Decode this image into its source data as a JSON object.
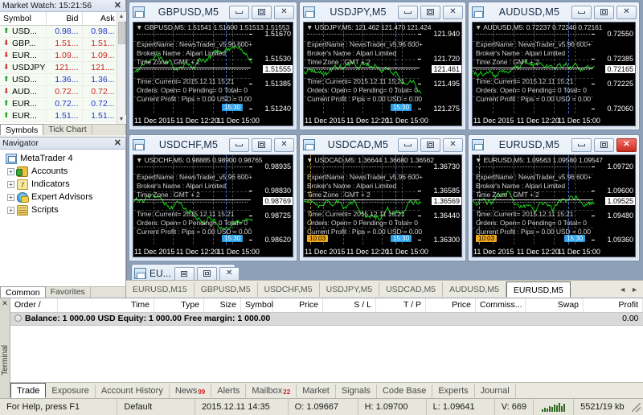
{
  "market_watch": {
    "title": "Market Watch: 15:21:56",
    "close_label": "✕",
    "columns": [
      "Symbol",
      "Bid",
      "Ask"
    ],
    "rows": [
      {
        "dir": "up",
        "symbol": "USD...",
        "bid": "0.98...",
        "ask": "0.98...",
        "px": "up"
      },
      {
        "dir": "down",
        "symbol": "GBP...",
        "bid": "1.51...",
        "ask": "1.51...",
        "px": "down"
      },
      {
        "dir": "down",
        "symbol": "EUR...",
        "bid": "1.09...",
        "ask": "1.09...",
        "px": "down"
      },
      {
        "dir": "down",
        "symbol": "USDJPY",
        "bid": "121....",
        "ask": "121....",
        "px": "down"
      },
      {
        "dir": "up",
        "symbol": "USD...",
        "bid": "1.36...",
        "ask": "1.36...",
        "px": "up"
      },
      {
        "dir": "down",
        "symbol": "AUD...",
        "bid": "0.72...",
        "ask": "0.72...",
        "px": "down"
      },
      {
        "dir": "up",
        "symbol": "EUR...",
        "bid": "0.72...",
        "ask": "0.72...",
        "px": "up"
      },
      {
        "dir": "up",
        "symbol": "EUR...",
        "bid": "1.51...",
        "ask": "1.51...",
        "px": "up"
      }
    ],
    "tabs": [
      {
        "label": "Symbols",
        "selected": true
      },
      {
        "label": "Tick Chart",
        "selected": false
      }
    ],
    "scroll_up": "▲",
    "scroll_down": "▼"
  },
  "navigator": {
    "title": "Navigator",
    "close_label": "✕",
    "items": [
      {
        "label": "MetaTrader 4",
        "icon": "platform-icon",
        "root": true,
        "expander": ""
      },
      {
        "label": "Accounts",
        "icon": "accounts-icon",
        "root": false,
        "expander": "+"
      },
      {
        "label": "Indicators",
        "icon": "indicators-icon",
        "root": false,
        "expander": "+"
      },
      {
        "label": "Expert Advisors",
        "icon": "expert-advisors-icon",
        "root": false,
        "expander": "+"
      },
      {
        "label": "Scripts",
        "icon": "scripts-icon",
        "root": false,
        "expander": "+"
      }
    ],
    "tabs": [
      {
        "label": "Common",
        "selected": true
      },
      {
        "label": "Favorites",
        "selected": false
      }
    ]
  },
  "chart_windows": [
    {
      "title": "GBPUSD,M5",
      "active": false,
      "header": "GBPUSD,M5: 1.51541 1.51600 1.51513 1.51553",
      "ea_name": "ExpertName : NewsTrader_v5.96 600+",
      "broker": "Broker's Name :   Alpari Limited",
      "timezone": "Time Zone : GMT + 2",
      "time_current": "Time: Current= 2015.12.11 15:21",
      "orders": "Orders: Open= 0 Pending= 0 Total= 0",
      "profit": "Current Profit :  Pips = 0.00 USD = 0.00",
      "price_labels": [
        "1.51670",
        "1.51530",
        "1.51385",
        "1.51240"
      ],
      "current_price": "1.51555",
      "time_labels": [
        "11 Dec 2015",
        "11 Dec 12:20",
        "11 Dec 15:00"
      ],
      "chips": [
        {
          "text": "15:30",
          "color": "blue"
        }
      ]
    },
    {
      "title": "USDJPY,M5",
      "active": false,
      "header": "USDJPY,M5: 121.462 121.470 121.424",
      "ea_name": "ExpertName : NewsTrader_v5.96 600+",
      "broker": "Broker's Name :   Alpari Limited",
      "timezone": "Time Zone : GMT + 2",
      "time_current": "Time: Current= 2015.12.11 15:21",
      "orders": "Orders: Open= 0 Pending= 0 Total= 0",
      "profit": "Current Profit :  Pips = 0.00 USD = 0.00",
      "price_labels": [
        "121.940",
        "121.720",
        "121.495",
        "121.275"
      ],
      "current_price": "121.461",
      "time_labels": [
        "11 Dec 2015",
        "11 Dec 12:20",
        "11 Dec 15:00"
      ],
      "chips": [
        {
          "text": "15:30",
          "color": "blue"
        }
      ]
    },
    {
      "title": "AUDUSD,M5",
      "active": false,
      "header": "AUDUSD,M5: 0.72237 0.72240 0.72161",
      "ea_name": "ExpertName : NewsTrader_v5.96 600+",
      "broker": "Broker's Name :   Alpari Limited",
      "timezone": "Time Zone : GMT + 2",
      "time_current": "Time: Current= 2015.12.11 15:21",
      "orders": "Orders: Open= 0 Pending= 0 Total= 0",
      "profit": "Current Profit :  Pips = 0.00 USD = 0.00",
      "price_labels": [
        "0.72550",
        "0.72385",
        "0.72225",
        "0.72060"
      ],
      "current_price": "0.72165",
      "time_labels": [
        "11 Dec 2015",
        "11 Dec 12:20",
        "11 Dec 15:00"
      ],
      "chips": []
    },
    {
      "title": "USDCHF,M5",
      "active": false,
      "header": "USDCHF,M5: 0.98885 0.98900 0.98765",
      "ea_name": "ExpertName : NewsTrader_v5.96 600+",
      "broker": "Broker's Name :   Alpari Limited",
      "timezone": "Time Zone : GMT + 2",
      "time_current": "Time: Current= 2015.12.11 15:21",
      "orders": "Orders: Open= 0 Pending= 0 Total= 0",
      "profit": "Current Profit :  Pips = 0.00 USD = 0.00",
      "price_labels": [
        "0.98935",
        "0.98830",
        "0.98725",
        "0.98620"
      ],
      "current_price": "0.98769",
      "time_labels": [
        "11 Dec 2015",
        "11 Dec 12:20",
        "11 Dec 15:00"
      ],
      "chips": [
        {
          "text": "15:30",
          "color": "blue"
        }
      ]
    },
    {
      "title": "USDCAD,M5",
      "active": false,
      "header": "USDCAD,M5: 1.36644 1.36680 1.36562",
      "ea_name": "ExpertName : NewsTrader_v5.96 600+",
      "broker": "Broker's Name :   Alpari Limited",
      "timezone": "Time Zone : GMT + 2",
      "time_current": "Time: Current= 2015.12.11 15:21",
      "orders": "Orders: Open= 0 Pending= 0 Total= 0",
      "profit": "Current Profit :  Pips = 0.00 USD = 0.00",
      "price_labels": [
        "1.36730",
        "1.36585",
        "1.36440",
        "1.36300"
      ],
      "current_price": "1.36569",
      "time_labels": [
        "11 Dec 2015",
        "11 Dec 12:20",
        "11 Dec 15:00"
      ],
      "chips": [
        {
          "text": "10:03",
          "color": "orange"
        },
        {
          "text": "15:30",
          "color": "blue"
        }
      ]
    },
    {
      "title": "EURUSD,M5",
      "active": true,
      "header": "EURUSD,M5: 1.09563 1.09580 1.09547",
      "ea_name": "ExpertName : NewsTrader_v5.96 600+",
      "broker": "Broker's Name :   Alpari Limited",
      "timezone": "Time Zone : GMT + 2",
      "time_current": "Time: Current= 2015.12.11 15:21",
      "orders": "Orders: Open= 0 Pending= 0 Total= 0",
      "profit": "Current Profit :  Pips = 0.00 USD = 0.00",
      "price_labels": [
        "1.09720",
        "1.09600",
        "1.09480",
        "1.09360"
      ],
      "current_price": "1.09525",
      "time_labels": [
        "11 Dec 2015",
        "11 Dec 12:20",
        "11 Dec 15:00"
      ],
      "chips": [
        {
          "text": "10:03",
          "color": "orange"
        },
        {
          "text": "15:30",
          "color": "blue"
        }
      ]
    }
  ],
  "minimized_window": {
    "title": "EU...",
    "restore_label": "restore-icon",
    "max_label": "maximize-icon",
    "close_label": "close-icon"
  },
  "chart_tabs": {
    "items": [
      {
        "label": "EURUSD,M15",
        "active": false
      },
      {
        "label": "GBPUSD,M5",
        "active": false
      },
      {
        "label": "USDCHF,M5",
        "active": false
      },
      {
        "label": "USDJPY,M5",
        "active": false
      },
      {
        "label": "USDCAD,M5",
        "active": false
      },
      {
        "label": "AUDUSD,M5",
        "active": false
      },
      {
        "label": "EURUSD,M5",
        "active": true
      }
    ],
    "arrow_left": "◄",
    "arrow_right": "►"
  },
  "terminal": {
    "panel_label": "Terminal",
    "close_label": "✕",
    "columns": [
      "Order  /",
      "Time",
      "Type",
      "Size",
      "Symbol",
      "Price",
      "S / L",
      "T / P",
      "Price",
      "Commiss...",
      "Swap",
      "Profit"
    ],
    "balance_row": {
      "text": "Balance: 1 000.00 USD  Equity: 1 000.00  Free margin: 1 000.00",
      "profit": "0.00"
    },
    "tabs": [
      {
        "label": "Trade",
        "badge": "",
        "active": true
      },
      {
        "label": "Exposure",
        "badge": "",
        "active": false
      },
      {
        "label": "Account History",
        "badge": "",
        "active": false
      },
      {
        "label": "News",
        "badge": "99",
        "active": false
      },
      {
        "label": "Alerts",
        "badge": "",
        "active": false
      },
      {
        "label": "Mailbox",
        "badge": "22",
        "active": false
      },
      {
        "label": "Market",
        "badge": "",
        "active": false
      },
      {
        "label": "Signals",
        "badge": "",
        "active": false
      },
      {
        "label": "Code Base",
        "badge": "",
        "active": false
      },
      {
        "label": "Experts",
        "badge": "",
        "active": false
      },
      {
        "label": "Journal",
        "badge": "",
        "active": false
      }
    ]
  },
  "status_bar": {
    "help": "For Help, press F1",
    "profile": "Default",
    "datetime": "2015.12.11 14:35",
    "open": "O: 1.09667",
    "high": "H: 1.09700",
    "low": "L: 1.09641",
    "volume": "V: 669",
    "traffic": "5521/19 kb"
  }
}
